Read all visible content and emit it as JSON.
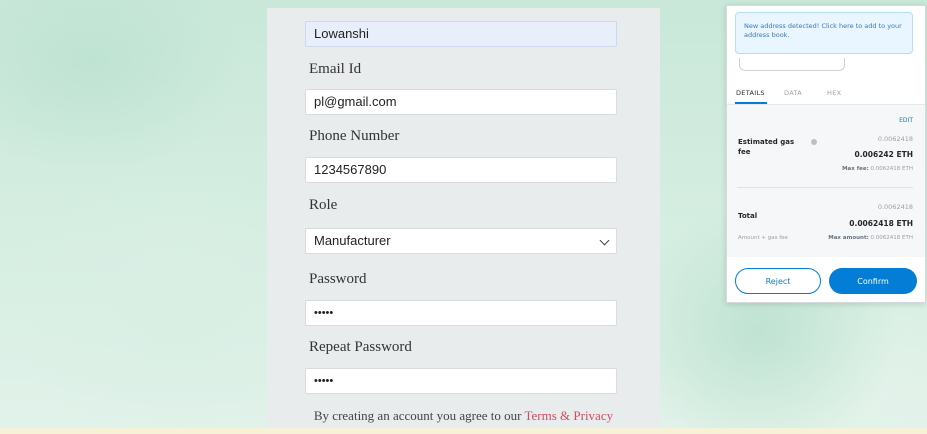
{
  "form": {
    "name_value": "Lowanshi",
    "email_label": "Email Id",
    "email_value": "pl@gmail.com",
    "phone_label": "Phone Number",
    "phone_value": "1234567890",
    "role_label": "Role",
    "role_value": "Manufacturer",
    "password_label": "Password",
    "password_value": "•••••",
    "repeat_password_label": "Repeat Password",
    "repeat_password_value": "•••••",
    "terms_text": "By creating an account you agree to our",
    "terms_link": "Terms & Privacy"
  },
  "metamask": {
    "notice": "New address detected! Click here to add to your address book.",
    "tabs": [
      "DETAILS",
      "DATA",
      "HEX"
    ],
    "edit_label": "EDIT",
    "gas_label": "Estimated gas fee",
    "gas_value_small": "0.0062418",
    "gas_value_big": "0.006242 ETH",
    "max_fee_label": "Max fee:",
    "max_fee_value": "0.0062418 ETH",
    "total_label": "Total",
    "total_value_small": "0.0062418",
    "total_value_big": "0.0062418 ETH",
    "amount_gas_label": "Amount + gas fee",
    "max_amount_label": "Max amount:",
    "max_amount_value": "0.0062418 ETH",
    "reject_label": "Reject",
    "confirm_label": "Confirm"
  },
  "colors": {
    "accent": "#037dd6",
    "link": "#d14b63",
    "panel": "#e9ecec",
    "background": "#cfe9dd"
  }
}
